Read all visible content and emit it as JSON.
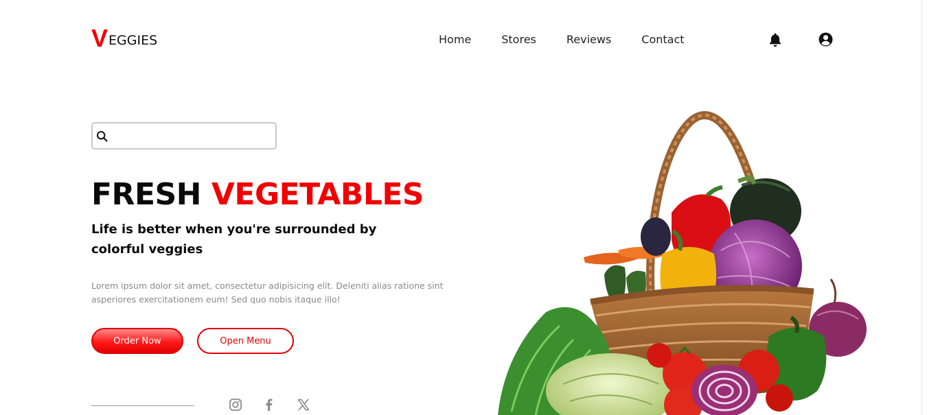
{
  "brand": {
    "initial": "V",
    "rest": "EGGIES",
    "accent": "#f00000"
  },
  "nav": {
    "items": [
      "Home",
      "Stores",
      "Reviews",
      "Contact"
    ]
  },
  "header_icons": {
    "notifications": "bell-icon",
    "account": "user-circle-icon"
  },
  "search": {
    "value": "",
    "placeholder": "",
    "icon": "search-icon"
  },
  "hero": {
    "title_part1": "FRESH",
    "title_part2": "VEGETABLES",
    "tagline": "Life is better when you're surrounded by colorful veggies",
    "body": "Lorem ipsum dolor sit amet, consectetur adipisicing elit. Deleniti alias ratione sint asperiores exercitationem eum! Sed quo nobis itaque illo!",
    "primary_button": "Order Now",
    "secondary_button": "Open Menu",
    "image": "vegetable-basket-image"
  },
  "social": {
    "icons": [
      "instagram-icon",
      "facebook-icon",
      "x-icon"
    ]
  },
  "colors": {
    "accent": "#f00000",
    "text": "#0a0a0a",
    "muted": "#8a8a8a",
    "social": "#8c8c8c"
  }
}
